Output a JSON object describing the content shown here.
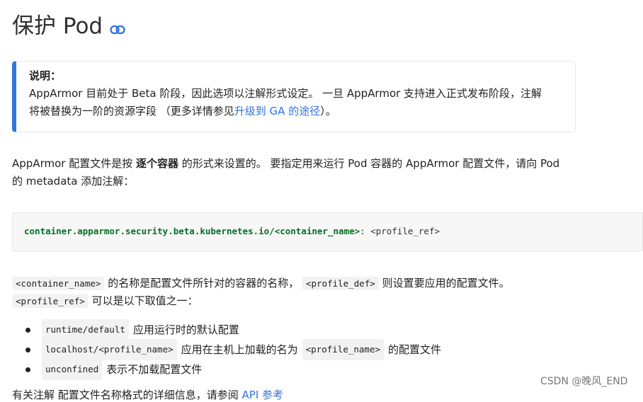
{
  "heading": {
    "title": "保护 Pod",
    "icon": "link-icon"
  },
  "note": {
    "title": "说明：",
    "line1": "AppArmor 目前处于 Beta 阶段，因此选项以注解形式设定。 一旦 AppArmor 支持进入正式发布阶段，注解",
    "line2_pre": "将被替换为一阶的资源字段 （更多详情参见",
    "link": "升级到 GA 的途径",
    "line2_post": "）。",
    "accent_color": "#3176d9"
  },
  "para1": {
    "pre": "AppArmor 配置文件是按 ",
    "bold": "逐个容器",
    "post": " 的形式来设置的。 要指定用来运行 Pod 容器的 AppArmor 配置文件，请向 Pod 的 metadata 添加注解："
  },
  "code_block": {
    "key": "container.apparmor.security.beta.kubernetes.io/<container_name>",
    "rest": ": <profile_ref>"
  },
  "para2": {
    "code1": "<container_name>",
    "text1": " 的名称是配置文件所针对的容器的名称， ",
    "code2": "<profile_def>",
    "text2": " 则设置要应用的配置文件。",
    "code3": "<profile_ref>",
    "text3": " 可以是以下取值之一："
  },
  "list": [
    {
      "code": "runtime/default",
      "text": "应用运行时的默认配置"
    },
    {
      "code": "localhost/<profile_name>",
      "text": "应用在主机上加载的名为",
      "code2": "<profile_name>",
      "text2": "的配置文件"
    },
    {
      "code": "unconfined",
      "text": "表示不加载配置文件"
    }
  ],
  "watermark": "CSDN @晚风_END",
  "cut_text": {
    "pre": "有关注解 配置文件名称格式的详细信息，请参阅 ",
    "link": "API 参考"
  }
}
